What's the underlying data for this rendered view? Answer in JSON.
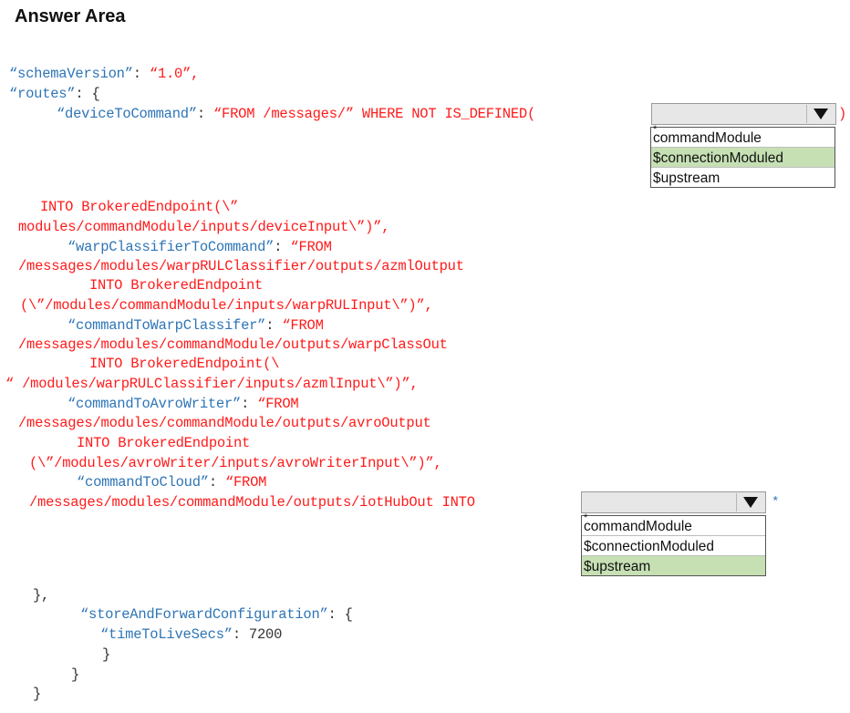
{
  "title": "Answer Area",
  "code": {
    "schema_key": "“schemaVersion”",
    "schema_colon": ": ",
    "schema_value": "“1.0”,",
    "routes_key": "“routes”",
    "routes_tail": ": {",
    "d2c_key": "“deviceToCommand”",
    "d2c_colon": ": ",
    "d2c_value": "“FROM /messages/” WHERE NOT IS_DEFINED(",
    "l_into1": "INTO BrokeredEndpoint(\\”",
    "l_mod1": "modules/commandModule/inputs/deviceInput\\”)”,",
    "warp_key": "“warpClassifierToCommand”",
    "warp_colon": ": ",
    "warp_value": "“FROM",
    "l_warp_from": "/messages/modules/warpRULClassifier/outputs/azmlOutput",
    "l_into2": "INTO BrokeredEndpoint",
    "l_mod2": "(\\”/modules/commandModule/inputs/warpRULInput\\”)”,",
    "cmdwarp_key": "“commandToWarpClassifer”",
    "cmdwarp_colon": ": ",
    "cmdwarp_value": "“FROM",
    "l_cmdwarp_from": "/messages/modules/commandModule/outputs/warpClassOut",
    "l_into3": "INTO BrokeredEndpoint(\\",
    "l_mod3": "“ /modules/warpRULClassifier/inputs/azmlInput\\”)”,",
    "avro_key": "“commandToAvroWriter”",
    "avro_colon": ": ",
    "avro_value": "“FROM",
    "l_avro_from": "/messages/modules/commandModule/outputs/avroOutput",
    "l_into4": "INTO BrokeredEndpoint",
    "l_mod4": "(\\”/modules/avroWriter/inputs/avroWriterInput\\”)”,",
    "cloud_key": "“commandToCloud”",
    "cloud_colon": ": ",
    "cloud_value": "“FROM",
    "l_cloud_from": "/messages/modules/commandModule/outputs/iotHubOut INTO",
    "close_routes": "},",
    "store_key": "“storeAndForwardConfiguration”",
    "store_tail": ": {",
    "ttl_key": "“timeToLiveSecs”",
    "ttl_value": ": 7200",
    "close_inner": "}",
    "close_store": "}",
    "close_root": "}",
    "paren_close": ")",
    "star": "*"
  },
  "dropdown1": {
    "selected_value": "",
    "options": [
      {
        "label": "commandModule",
        "selected": false
      },
      {
        "label": "$connectionModuled",
        "selected": true
      },
      {
        "label": "$upstream",
        "selected": false
      }
    ]
  },
  "dropdown2": {
    "selected_value": "",
    "options": [
      {
        "label": "commandModule",
        "selected": false
      },
      {
        "label": "$connectionModuled",
        "selected": false
      },
      {
        "label": "$upstream",
        "selected": true
      }
    ]
  },
  "option_marker": "*",
  "colors": {
    "key_blue": "#2e75b6",
    "value_red": "#ff1a1a",
    "selected_green": "#c6e0b4"
  }
}
